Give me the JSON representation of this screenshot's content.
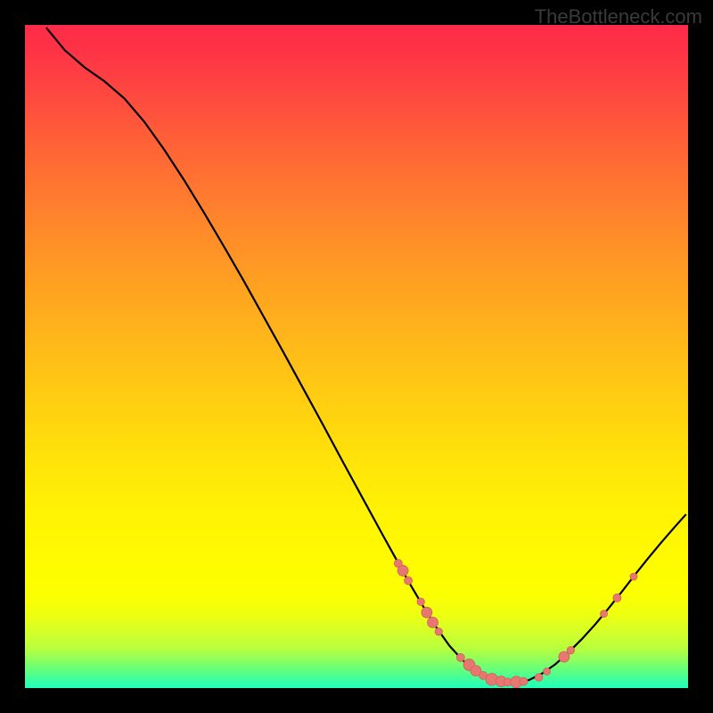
{
  "watermark": "TheBottleneck.com",
  "colors": {
    "dot_fill": "#e77871",
    "dot_stroke": "#d45f58",
    "curve_stroke": "#000000"
  },
  "chart_data": {
    "type": "line",
    "title": "",
    "xlabel": "",
    "ylabel": "",
    "xlim": [
      0,
      100
    ],
    "ylim": [
      0,
      100
    ],
    "curve": [
      {
        "x": 3.2,
        "y": 99.6
      },
      {
        "x": 6.0,
        "y": 96.2
      },
      {
        "x": 9.0,
        "y": 93.6
      },
      {
        "x": 12.0,
        "y": 91.5
      },
      {
        "x": 15.0,
        "y": 88.9
      },
      {
        "x": 18.0,
        "y": 85.4
      },
      {
        "x": 21.0,
        "y": 81.2
      },
      {
        "x": 24.0,
        "y": 76.6
      },
      {
        "x": 27.0,
        "y": 71.7
      },
      {
        "x": 30.0,
        "y": 66.6
      },
      {
        "x": 33.0,
        "y": 61.4
      },
      {
        "x": 36.0,
        "y": 56.0
      },
      {
        "x": 39.0,
        "y": 50.6
      },
      {
        "x": 42.0,
        "y": 45.1
      },
      {
        "x": 45.0,
        "y": 39.6
      },
      {
        "x": 48.0,
        "y": 34.0
      },
      {
        "x": 51.0,
        "y": 28.5
      },
      {
        "x": 54.0,
        "y": 23.0
      },
      {
        "x": 56.0,
        "y": 19.4
      },
      {
        "x": 58.0,
        "y": 15.8
      },
      {
        "x": 60.0,
        "y": 12.4
      },
      {
        "x": 62.0,
        "y": 9.2
      },
      {
        "x": 64.0,
        "y": 6.4
      },
      {
        "x": 66.0,
        "y": 4.2
      },
      {
        "x": 68.0,
        "y": 2.6
      },
      {
        "x": 70.0,
        "y": 1.5
      },
      {
        "x": 72.0,
        "y": 0.9
      },
      {
        "x": 74.0,
        "y": 0.8
      },
      {
        "x": 76.0,
        "y": 1.2
      },
      {
        "x": 78.0,
        "y": 2.2
      },
      {
        "x": 80.0,
        "y": 3.6
      },
      {
        "x": 82.0,
        "y": 5.4
      },
      {
        "x": 84.0,
        "y": 7.4
      },
      {
        "x": 86.0,
        "y": 9.6
      },
      {
        "x": 88.0,
        "y": 12.0
      },
      {
        "x": 90.0,
        "y": 14.5
      },
      {
        "x": 92.0,
        "y": 17.1
      },
      {
        "x": 94.0,
        "y": 19.6
      },
      {
        "x": 96.0,
        "y": 22.0
      },
      {
        "x": 98.0,
        "y": 24.3
      },
      {
        "x": 99.7,
        "y": 26.2
      }
    ],
    "points": [
      {
        "x": 56.3,
        "y": 18.8,
        "r": 4.5
      },
      {
        "x": 57.0,
        "y": 17.7,
        "r": 6.0
      },
      {
        "x": 57.8,
        "y": 16.2,
        "r": 4.5
      },
      {
        "x": 59.7,
        "y": 13.0,
        "r": 4.2
      },
      {
        "x": 60.6,
        "y": 11.4,
        "r": 6.0
      },
      {
        "x": 61.5,
        "y": 9.9,
        "r": 6.0
      },
      {
        "x": 62.4,
        "y": 8.5,
        "r": 4.2
      },
      {
        "x": 65.7,
        "y": 4.6,
        "r": 4.5
      },
      {
        "x": 67.0,
        "y": 3.5,
        "r": 6.5
      },
      {
        "x": 68.0,
        "y": 2.6,
        "r": 6.0
      },
      {
        "x": 69.1,
        "y": 1.9,
        "r": 4.5
      },
      {
        "x": 70.4,
        "y": 1.3,
        "r": 6.8
      },
      {
        "x": 71.8,
        "y": 1.0,
        "r": 6.0
      },
      {
        "x": 72.8,
        "y": 0.9,
        "r": 4.5
      },
      {
        "x": 74.1,
        "y": 0.9,
        "r": 6.5
      },
      {
        "x": 75.2,
        "y": 1.0,
        "r": 4.5
      },
      {
        "x": 77.5,
        "y": 1.6,
        "r": 4.3
      },
      {
        "x": 78.7,
        "y": 2.5,
        "r": 4.0
      },
      {
        "x": 81.3,
        "y": 4.7,
        "r": 6.0
      },
      {
        "x": 82.3,
        "y": 5.7,
        "r": 4.2
      },
      {
        "x": 87.3,
        "y": 11.2,
        "r": 4.0
      },
      {
        "x": 89.3,
        "y": 13.6,
        "r": 4.5
      },
      {
        "x": 91.8,
        "y": 16.8,
        "r": 4.0
      }
    ]
  }
}
